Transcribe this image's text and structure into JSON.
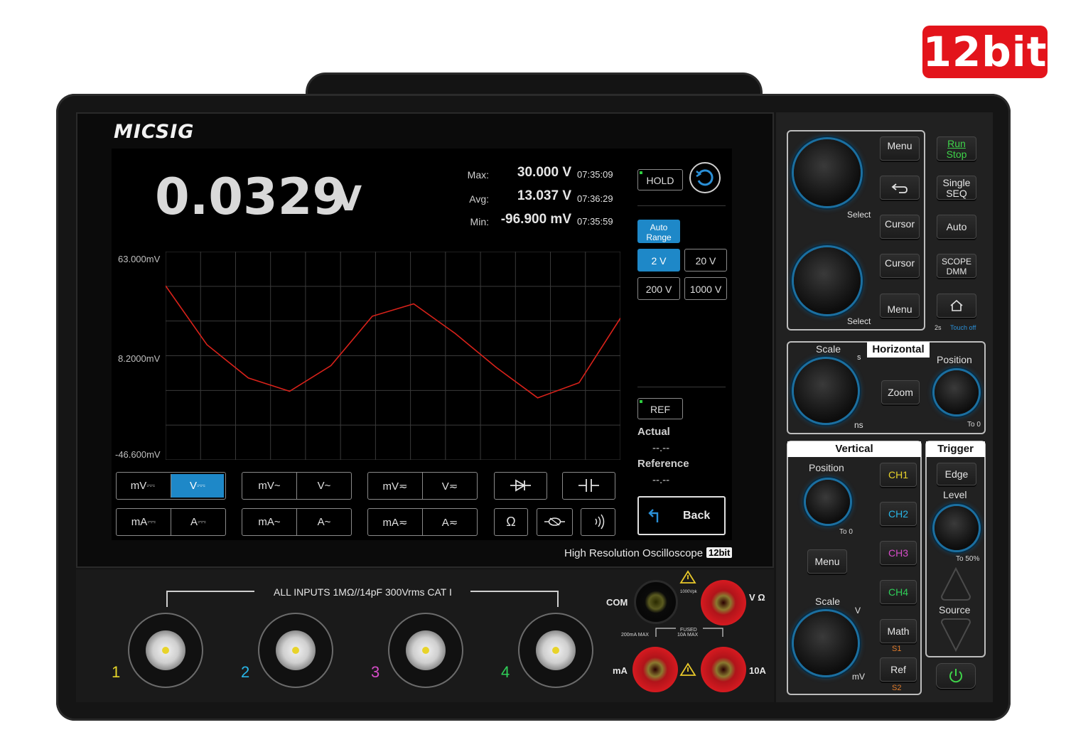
{
  "badge": "12bit",
  "logo": "MICSIG",
  "reading": {
    "value": "0.0329",
    "unit": "V"
  },
  "stats": {
    "max_label": "Max:",
    "max_value": "30.000 V",
    "max_time": "07:35:09",
    "avg_label": "Avg:",
    "avg_value": "13.037 V",
    "avg_time": "07:36:29",
    "min_label": "Min:",
    "min_value": "-96.900 mV",
    "min_time": "07:35:59"
  },
  "chart_data": {
    "type": "line",
    "y_ticks": [
      "63.000mV",
      "8.2000mV",
      "-46.600mV"
    ],
    "ylim": [
      -46.6,
      63.0
    ],
    "grid": true,
    "series": [
      {
        "color": "#d9221a",
        "x": [
          0,
          1,
          2,
          3,
          4,
          5,
          6,
          7,
          8,
          9,
          10,
          11
        ],
        "values": [
          45.0,
          14.0,
          -3.5,
          -10.5,
          3.0,
          29.0,
          35.5,
          20.0,
          2.0,
          -14.0,
          -6.0,
          28.0
        ]
      }
    ]
  },
  "side": {
    "hold": "HOLD",
    "auto_range": "Auto Range",
    "ranges": [
      "2 V",
      "20 V",
      "200 V",
      "1000 V"
    ],
    "ref": "REF",
    "actual_label": "Actual",
    "actual_value": "--.--",
    "reference_label": "Reference",
    "reference_value": "--.--",
    "back": "Back"
  },
  "modes": {
    "row1": [
      [
        "mV⎓",
        "V⎓"
      ],
      [
        "mV~",
        "V~"
      ],
      [
        "mV≂",
        "V≂"
      ]
    ],
    "row2": [
      [
        "mA⎓",
        "A⎓"
      ],
      [
        "mA~",
        "A~"
      ],
      [
        "mA≂",
        "A≂"
      ]
    ],
    "ohm": "Ω"
  },
  "caption": {
    "text": "High Resolution Oscilloscope",
    "bit": "12bit"
  },
  "inputs_label": "ALL INPUTS 1MΩ//14pF 300Vrms CAT I",
  "channels": [
    {
      "num": "1",
      "color": "#e6d629"
    },
    {
      "num": "2",
      "color": "#28b6e8"
    },
    {
      "num": "3",
      "color": "#d64cc8"
    },
    {
      "num": "4",
      "color": "#2fcf58"
    }
  ],
  "jacks": {
    "com": "COM",
    "ma": "mA",
    "a10": "10A",
    "v_ohm": "V Ω",
    "warn1": "1000Vpk",
    "ma_max": "200mA MAX",
    "fused": "FUSED",
    "fused2": "10A MAX"
  },
  "panel": {
    "menu_top": "Menu",
    "cursor1": "Cursor",
    "cursor2": "Cursor",
    "menu_bottom": "Menu",
    "select": "Select",
    "run": "Run",
    "stop": "Stop",
    "single": "Single",
    "seq": "SEQ",
    "auto": "Auto",
    "scope": "SCOPE",
    "dmm": "DMM",
    "touch_prefix": "2s",
    "touch_off": "Touch off",
    "horizontal": "Horizontal",
    "scale": "Scale",
    "position": "Position",
    "zoom": "Zoom",
    "s": "s",
    "ns": "ns",
    "to0": "To 0",
    "vertical": "Vertical",
    "v_position": "Position",
    "v_scale": "Scale",
    "ch1": "CH1",
    "ch2": "CH2",
    "ch3": "CH3",
    "ch4": "CH4",
    "math": "Math",
    "s1": "S1",
    "ref": "Ref",
    "s2": "S2",
    "v_menu": "Menu",
    "V": "V",
    "mV": "mV",
    "trigger": "Trigger",
    "edge": "Edge",
    "level": "Level",
    "to50": "To 50%",
    "source": "Source"
  }
}
